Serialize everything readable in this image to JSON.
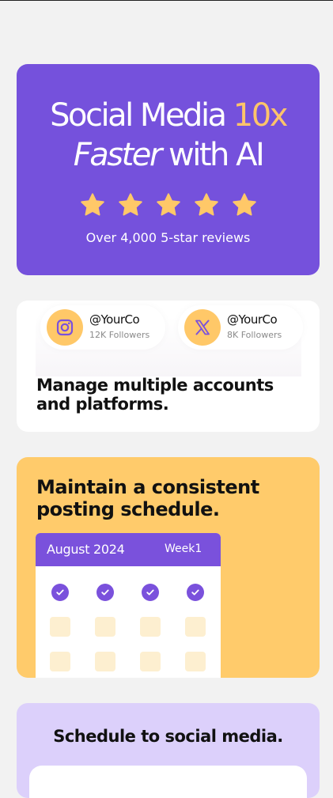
{
  "hero": {
    "title_part1": "Social Media ",
    "title_highlight": "10x",
    "title_italic": "Faster",
    "title_part2": " with AI",
    "rating_stars": 5,
    "reviews": "Over 4,000 5-star reviews",
    "bg_color": "#7551dc",
    "highlight_color": "#ffc46a",
    "star_color": "#ffc868"
  },
  "accounts": {
    "items": [
      {
        "icon": "instagram-icon",
        "handle": "@YourCo",
        "followers": "12K Followers"
      },
      {
        "icon": "x-twitter-icon",
        "handle": "@YourCo",
        "followers": "8K Followers"
      }
    ],
    "heading": "Manage multiple accounts and platforms."
  },
  "schedule": {
    "heading": "Maintain a consistent posting schedule.",
    "calendar": {
      "month": "August 2024",
      "week": "Week1"
    },
    "bg_color": "#ffcb6b",
    "accent_color": "#7a51dc"
  },
  "social": {
    "heading": "Schedule to social media.",
    "bg_color": "#dcd0fb"
  }
}
